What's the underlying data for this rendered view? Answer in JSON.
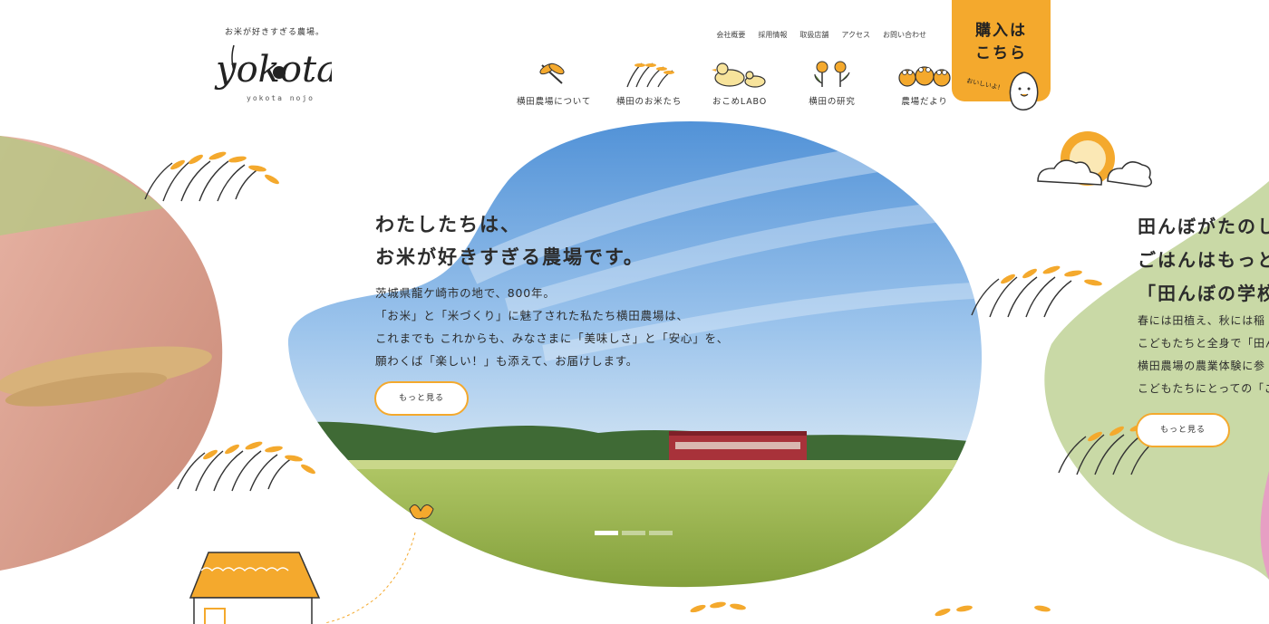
{
  "brand": {
    "tagline": "お米が好きすぎる農場。",
    "logo_text": "yokota",
    "sub": "yokota nojo"
  },
  "utility_nav": [
    "会社概要",
    "採用情報",
    "取扱店舗",
    "アクセス",
    "お問い合わせ"
  ],
  "main_nav": [
    {
      "label": "横田農場について",
      "icon": "dragonfly-icon"
    },
    {
      "label": "横田のお米たち",
      "icon": "rice-ear-icon"
    },
    {
      "label": "おこめLABO",
      "icon": "duck-icon"
    },
    {
      "label": "横田の研究",
      "icon": "flower-icon"
    },
    {
      "label": "農場だより",
      "icon": "frogs-icon"
    }
  ],
  "buy": {
    "line1": "購入は",
    "line2": "こちら",
    "badge": "おいしいよ!"
  },
  "hero": {
    "title_1": "わたしたちは、",
    "title_2": "お米が好きすぎる農場です。",
    "body": [
      "茨城県龍ケ崎市の地で、800年。",
      "「お米」と「米づくり」に魅了された私たち横田農場は、",
      "これまでも これからも、みなさまに「美味しさ」と「安心」を、",
      "願わくば「楽しい！」も添えて、お届けします。"
    ],
    "more": "もっと見る"
  },
  "next_slide": {
    "title": [
      "田んぼがたのし",
      "ごはんはもっと",
      "「田んぼの学校"
    ],
    "body": [
      "春には田植え、秋には稲",
      "こどもたちと全身で「田ん",
      "横田農場の農業体験に参",
      "こどもたちにとっての「ご"
    ],
    "more": "もっと見る"
  },
  "slider": {
    "count": 3,
    "active": 0
  },
  "colors": {
    "accent": "#f4a92d",
    "text": "#2c2c2c",
    "sky": "#6fa8e0",
    "field": "#8fb043"
  }
}
